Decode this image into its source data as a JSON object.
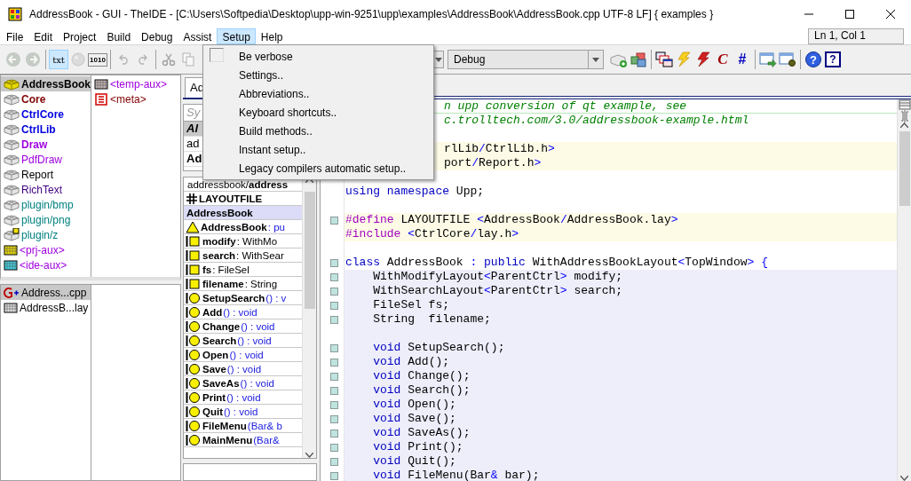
{
  "window": {
    "title": "AddressBook - GUI - TheIDE - [C:\\Users\\Softpedia\\Desktop\\upp-win-9251\\upp\\examples\\AddressBook\\AddressBook.cpp UTF-8 LF] { examples }"
  },
  "menu": [
    {
      "label": "File",
      "selected": false
    },
    {
      "label": "Edit",
      "selected": false
    },
    {
      "label": "Project",
      "selected": false
    },
    {
      "label": "Build",
      "selected": false
    },
    {
      "label": "Debug",
      "selected": false
    },
    {
      "label": "Assist",
      "selected": false
    },
    {
      "label": "Setup",
      "selected": true
    },
    {
      "label": "Help",
      "selected": false
    }
  ],
  "position": "Ln 1, Col 1",
  "setup_menu": [
    {
      "label": "Be verbose",
      "kind": "check",
      "checked": false
    },
    {
      "label": "Settings..",
      "kind": "item"
    },
    {
      "label": "Abbreviations..",
      "kind": "item"
    },
    {
      "label": "Keyboard shortcuts..",
      "kind": "item"
    },
    {
      "label": "Build methods..",
      "kind": "item"
    },
    {
      "label": "Instant setup..",
      "kind": "item"
    },
    {
      "label": "Legacy compilers automatic setup..",
      "kind": "item"
    }
  ],
  "toolbar_left": [
    {
      "kind": "back",
      "disabled": true,
      "pressed": false
    },
    {
      "kind": "forward",
      "disabled": true,
      "pressed": false
    },
    {
      "kind": "sep"
    },
    {
      "kind": "txt",
      "text": "txt",
      "disabled": false,
      "pressed": true
    },
    {
      "kind": "ball",
      "disabled": true,
      "pressed": false
    },
    {
      "kind": "binary",
      "text": "1010",
      "disabled": false,
      "pressed": false
    },
    {
      "kind": "sep"
    },
    {
      "kind": "undo",
      "disabled": true,
      "pressed": false
    },
    {
      "kind": "redo",
      "disabled": true,
      "pressed": false
    },
    {
      "kind": "sep"
    },
    {
      "kind": "cut",
      "disabled": true,
      "pressed": false
    },
    {
      "kind": "copy",
      "disabled": true,
      "pressed": false
    }
  ],
  "build_mode": {
    "value": "Debug"
  },
  "toolbar_right": [
    {
      "kind": "package-add",
      "disabled": false,
      "pressed": false
    },
    {
      "kind": "cubes",
      "disabled": false,
      "pressed": false
    },
    {
      "kind": "sep"
    },
    {
      "kind": "windows",
      "disabled": false,
      "pressed": false
    },
    {
      "kind": "bolt-yellow",
      "disabled": false,
      "pressed": false
    },
    {
      "kind": "bolt-red",
      "disabled": false,
      "pressed": false
    },
    {
      "kind": "c-glyph",
      "text": "C",
      "disabled": false,
      "pressed": false
    },
    {
      "kind": "hash-glyph",
      "text": "#",
      "disabled": false,
      "pressed": false
    },
    {
      "kind": "sep"
    },
    {
      "kind": "run",
      "disabled": false,
      "pressed": false
    },
    {
      "kind": "debug",
      "disabled": false,
      "pressed": false
    },
    {
      "kind": "sep"
    },
    {
      "kind": "help-circle",
      "text": "?",
      "disabled": false,
      "pressed": false
    },
    {
      "kind": "help-box",
      "text": "?",
      "disabled": false,
      "pressed": false
    }
  ],
  "packages": [
    {
      "name": "AddressBook",
      "kind": "main",
      "color": "#000000",
      "bold": true,
      "selected": true
    },
    {
      "name": "Core",
      "kind": "package",
      "color": "#800000",
      "bold": true,
      "selected": false
    },
    {
      "name": "CtrlCore",
      "kind": "package",
      "color": "#0000e0",
      "bold": true,
      "selected": false
    },
    {
      "name": "CtrlLib",
      "kind": "package",
      "color": "#0000e0",
      "bold": true,
      "selected": false
    },
    {
      "name": "Draw",
      "kind": "package",
      "color": "#a000e0",
      "bold": true,
      "selected": false
    },
    {
      "name": "PdfDraw",
      "kind": "package",
      "color": "#a000e0",
      "bold": false,
      "selected": false
    },
    {
      "name": "Report",
      "kind": "package",
      "color": "#000000",
      "bold": false,
      "selected": false
    },
    {
      "name": "RichText",
      "kind": "package",
      "color": "#400080",
      "bold": false,
      "selected": false
    },
    {
      "name": "plugin/bmp",
      "kind": "package",
      "color": "#008080",
      "bold": false,
      "selected": false
    },
    {
      "name": "plugin/png",
      "kind": "package",
      "color": "#008080",
      "bold": false,
      "selected": false
    },
    {
      "name": "plugin/z",
      "kind": "flagged",
      "color": "#008080",
      "bold": false,
      "selected": false
    },
    {
      "name": "<prj-aux>",
      "kind": "aux-yellow",
      "color": "#a000e0",
      "bold": false,
      "selected": false
    },
    {
      "name": "<ide-aux>",
      "kind": "aux-cyan",
      "color": "#a000e0",
      "bold": false,
      "selected": false
    }
  ],
  "package_files": [
    {
      "name": "<temp-aux>",
      "kind": "aux-gray",
      "color": "#a000e0"
    },
    {
      "name": "<meta>",
      "kind": "meta",
      "color": "#800000"
    }
  ],
  "files": [
    {
      "name": "Address...cpp",
      "kind": "cpp",
      "selected": true
    },
    {
      "name": "AddressB...lay",
      "kind": "lay",
      "selected": false
    }
  ],
  "editor_tab": "Ad",
  "symbol_search": {
    "placeholder": "Sy"
  },
  "scopes": [
    {
      "name": "Al",
      "kind": "all",
      "selected": true
    },
    {
      "name": "ad",
      "kind": "file",
      "selected": false
    },
    {
      "name": "Ad",
      "kind": "class",
      "selected": false
    }
  ],
  "navigator": {
    "path": "addressbook/**address**",
    "items": [
      {
        "kind": "macro",
        "name": "LAYOUTFILE"
      },
      {
        "kind": "class",
        "name": "AddressBook"
      },
      {
        "kind": "ctor",
        "name": "AddressBook",
        "rest": " : pu"
      },
      {
        "kind": "member",
        "name": "modify",
        "rest": " : WithMo"
      },
      {
        "kind": "member",
        "name": "search",
        "rest": " : WithSear"
      },
      {
        "kind": "member",
        "name": "fs",
        "rest": " : FileSel"
      },
      {
        "kind": "member",
        "name": "filename",
        "rest": " : String"
      },
      {
        "kind": "method",
        "name": "SetupSearch",
        "rest": "() : v"
      },
      {
        "kind": "method",
        "name": "Add",
        "rest": "() : void"
      },
      {
        "kind": "method",
        "name": "Change",
        "rest": "() : void"
      },
      {
        "kind": "method",
        "name": "Search",
        "rest": "() : void"
      },
      {
        "kind": "method",
        "name": "Open",
        "rest": "() : void"
      },
      {
        "kind": "method",
        "name": "Save",
        "rest": "() : void"
      },
      {
        "kind": "method",
        "name": "SaveAs",
        "rest": "() : void"
      },
      {
        "kind": "method",
        "name": "Print",
        "rest": "() : void"
      },
      {
        "kind": "method",
        "name": "Quit",
        "rest": "() : void"
      },
      {
        "kind": "method",
        "name": "FileMenu",
        "rest": "(Bar& b"
      },
      {
        "kind": "method",
        "name": "MainMenu",
        "rest": "(Bar&"
      }
    ]
  },
  "code": [
    {
      "kind": "plain",
      "cut": true,
      "tokens": [
        {
          "kind": "comment",
          "text": "n upp conversion of qt example, see"
        }
      ]
    },
    {
      "kind": "plain",
      "cut": true,
      "tokens": [
        {
          "kind": "comment",
          "text": "c.trolltech.com/3.0/addressbook-example.html"
        }
      ]
    },
    {
      "kind": "plain"
    },
    {
      "kind": "include",
      "cut": true,
      "tokens": [
        {
          "kind": "plain",
          "text": "rlLib"
        },
        {
          "kind": "op",
          "text": "/"
        },
        {
          "kind": "plain",
          "text": "CtrlLib.h"
        },
        {
          "kind": "op",
          "text": ">"
        }
      ]
    },
    {
      "kind": "include",
      "cut": true,
      "tokens": [
        {
          "kind": "plain",
          "text": "port"
        },
        {
          "kind": "op",
          "text": "/"
        },
        {
          "kind": "plain",
          "text": "Report.h"
        },
        {
          "kind": "op",
          "text": ">"
        }
      ]
    },
    {
      "kind": "plain"
    },
    {
      "kind": "plain",
      "cut": false,
      "marker": false,
      "tokens": [
        {
          "kind": "keyword",
          "text": "using namespace"
        },
        {
          "kind": "plain",
          "text": " Upp;"
        }
      ]
    },
    {
      "kind": "plain",
      "marker": false
    },
    {
      "kind": "include",
      "cut": false,
      "marker": true,
      "tokens": [
        {
          "kind": "preproc",
          "text": "#define"
        },
        {
          "kind": "plain",
          "text": " LAYOUTFILE "
        },
        {
          "kind": "op",
          "text": "<"
        },
        {
          "kind": "plain",
          "text": "AddressBook"
        },
        {
          "kind": "op",
          "text": "/"
        },
        {
          "kind": "plain",
          "text": "AddressBook.lay"
        },
        {
          "kind": "op",
          "text": ">"
        }
      ]
    },
    {
      "kind": "include",
      "cut": false,
      "marker": false,
      "tokens": [
        {
          "kind": "preproc",
          "text": "#include "
        },
        {
          "kind": "op",
          "text": "<"
        },
        {
          "kind": "plain",
          "text": "CtrlCore"
        },
        {
          "kind": "op",
          "text": "/"
        },
        {
          "kind": "plain",
          "text": "lay.h"
        },
        {
          "kind": "op",
          "text": ">"
        }
      ]
    },
    {
      "kind": "plain",
      "marker": false
    },
    {
      "kind": "plain",
      "cut": false,
      "marker": true,
      "tokens": [
        {
          "kind": "keyword",
          "text": "class"
        },
        {
          "kind": "plain",
          "text": " AddressBook "
        },
        {
          "kind": "op",
          "text": ": "
        },
        {
          "kind": "keyword",
          "text": "public"
        },
        {
          "kind": "plain",
          "text": " WithAddressBookLayout"
        },
        {
          "kind": "op",
          "text": "<"
        },
        {
          "kind": "plain",
          "text": "TopWindow"
        },
        {
          "kind": "op",
          "text": "> {"
        }
      ]
    },
    {
      "kind": "class",
      "cut": false,
      "marker": true,
      "tokens": [
        {
          "kind": "plain",
          "text": "    WithModifyLayout"
        },
        {
          "kind": "op",
          "text": "<"
        },
        {
          "kind": "plain",
          "text": "ParentCtrl"
        },
        {
          "kind": "op",
          "text": ">"
        },
        {
          "kind": "plain",
          "text": " modify;"
        }
      ]
    },
    {
      "kind": "class",
      "cut": false,
      "marker": true,
      "tokens": [
        {
          "kind": "plain",
          "text": "    WithSearchLayout"
        },
        {
          "kind": "op",
          "text": "<"
        },
        {
          "kind": "plain",
          "text": "ParentCtrl"
        },
        {
          "kind": "op",
          "text": ">"
        },
        {
          "kind": "plain",
          "text": " search;"
        }
      ]
    },
    {
      "kind": "class",
      "cut": false,
      "marker": true,
      "tokens": [
        {
          "kind": "plain",
          "text": "    FileSel fs;"
        }
      ]
    },
    {
      "kind": "class",
      "cut": false,
      "marker": true,
      "tokens": [
        {
          "kind": "plain",
          "text": "    String  filename;"
        }
      ]
    },
    {
      "kind": "class",
      "marker": false
    },
    {
      "kind": "class",
      "cut": false,
      "marker": true,
      "tokens": [
        {
          "kind": "keyword",
          "text": "    void"
        },
        {
          "kind": "plain",
          "text": " SetupSearch();"
        }
      ]
    },
    {
      "kind": "class",
      "cut": false,
      "marker": true,
      "tokens": [
        {
          "kind": "keyword",
          "text": "    void"
        },
        {
          "kind": "plain",
          "text": " Add();"
        }
      ]
    },
    {
      "kind": "class",
      "cut": false,
      "marker": true,
      "tokens": [
        {
          "kind": "keyword",
          "text": "    void"
        },
        {
          "kind": "plain",
          "text": " Change();"
        }
      ]
    },
    {
      "kind": "class",
      "cut": false,
      "marker": true,
      "tokens": [
        {
          "kind": "keyword",
          "text": "    void"
        },
        {
          "kind": "plain",
          "text": " Search();"
        }
      ]
    },
    {
      "kind": "class",
      "cut": false,
      "marker": true,
      "tokens": [
        {
          "kind": "keyword",
          "text": "    void"
        },
        {
          "kind": "plain",
          "text": " Open();"
        }
      ]
    },
    {
      "kind": "class",
      "cut": false,
      "marker": true,
      "tokens": [
        {
          "kind": "keyword",
          "text": "    void"
        },
        {
          "kind": "plain",
          "text": " Save();"
        }
      ]
    },
    {
      "kind": "class",
      "cut": false,
      "marker": true,
      "tokens": [
        {
          "kind": "keyword",
          "text": "    void"
        },
        {
          "kind": "plain",
          "text": " SaveAs();"
        }
      ]
    },
    {
      "kind": "class",
      "cut": false,
      "marker": true,
      "tokens": [
        {
          "kind": "keyword",
          "text": "    void"
        },
        {
          "kind": "plain",
          "text": " Print();"
        }
      ]
    },
    {
      "kind": "class",
      "cut": false,
      "marker": true,
      "tokens": [
        {
          "kind": "keyword",
          "text": "    void"
        },
        {
          "kind": "plain",
          "text": " Quit();"
        }
      ]
    },
    {
      "kind": "class",
      "cut": false,
      "marker": true,
      "tokens": [
        {
          "kind": "keyword",
          "text": "    void"
        },
        {
          "kind": "plain",
          "text": " FileMenu(Bar"
        },
        {
          "kind": "op",
          "text": "&"
        },
        {
          "kind": "plain",
          "text": " bar);"
        }
      ]
    }
  ]
}
